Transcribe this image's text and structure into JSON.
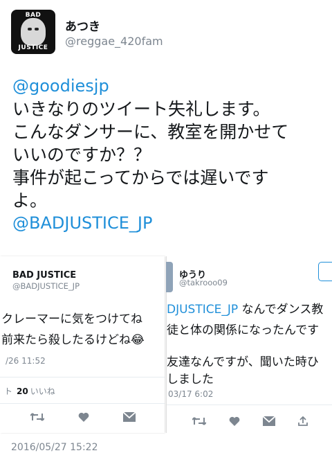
{
  "tweet": {
    "author_name": "あつき",
    "author_handle": "@reggae_420fam",
    "avatar_text_top": "BAD",
    "avatar_text_bottom": "JUSTICE",
    "mention_1": "@goodiesjp",
    "lines": [
      "いきなりのツイート失礼します。",
      "こんなダンサーに、教室を開かせて",
      "いいのですか？？",
      "事件が起こってからでは遅いです",
      "よ。"
    ],
    "mention_2": "@BADJUSTICE_JP",
    "timestamp": "2016/05/27 15:22"
  },
  "card_left": {
    "name": "BAD JUSTICE",
    "handle": "@BADJUSTICE_JP",
    "text_line_1": "クレーマーに気をつけてね",
    "text_line_2": "前来たら殺したるけどね😂",
    "time": "/26 11:52",
    "stats_prefix": "ト",
    "likes_count": "20",
    "likes_label": "いいね"
  },
  "card_right": {
    "name": "ゆうり",
    "handle": "@takrooo09",
    "text_line_1_mention": "DJUSTICE_JP",
    "text_line_1_rest": " なんでダンス教",
    "text_line_2": "徒と体の関係になったんです",
    "text_line_3": "友達なんですが、聞いた時ひ",
    "text_line_4": "しました",
    "time": "03/17 6:02"
  },
  "colors": {
    "link": "#1f8fd9",
    "muted": "#7d8690",
    "text": "#14171a"
  },
  "icons": [
    "retweet-icon",
    "heart-icon",
    "message-icon"
  ]
}
